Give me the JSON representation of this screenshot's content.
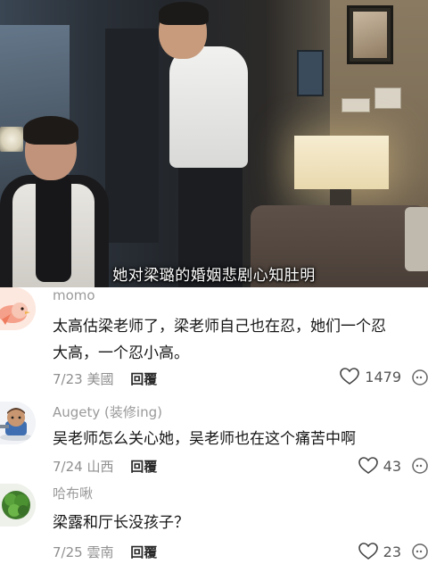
{
  "video": {
    "subtitle": "她对梁璐的婚姻悲剧心知肚明"
  },
  "comments": [
    {
      "username": "momo",
      "text_lines": [
        "太高估梁老师了，梁老师自己也在忍，她们一个忍",
        "大高，一个忍小高。"
      ],
      "date": "7/23",
      "location": "美國",
      "reply_label": "回覆",
      "likes": "1479",
      "avatar_icon": "cartoon-bird-avatar"
    },
    {
      "username": "Augety (装修ing)",
      "text_lines": [
        "吴老师怎么关心她，吴老师也在这个痛苦中啊"
      ],
      "date": "7/24",
      "location": "山西",
      "reply_label": "回覆",
      "likes": "43",
      "avatar_icon": "cartoon-character-avatar"
    },
    {
      "username": "哈布啾",
      "text_lines": [
        "梁露和厅长没孩子？"
      ],
      "date": "7/25",
      "location": "雲南",
      "reply_label": "回覆",
      "likes": "23",
      "avatar_icon": "green-plant-avatar"
    }
  ],
  "icons": {
    "like": "heart-outline-icon",
    "more": "more-options-icon"
  },
  "colors": {
    "username": "#9a9a9a",
    "comment_text": "#161616",
    "meta": "#8f8f8f"
  }
}
